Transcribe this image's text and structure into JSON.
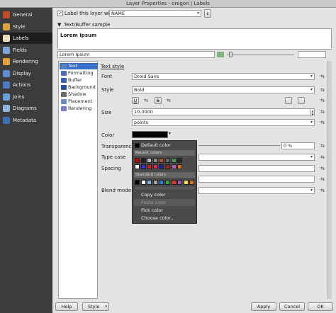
{
  "window": {
    "title": "Layer Properties - oregon | Labels"
  },
  "sidebar": {
    "items": [
      {
        "label": "General",
        "color": "#c04c2a"
      },
      {
        "label": "Style",
        "color": "#d9a441"
      },
      {
        "label": "Labels",
        "color": "#e8e0c0"
      },
      {
        "label": "Fields",
        "color": "#7ca7d8"
      },
      {
        "label": "Rendering",
        "color": "#e2a03a"
      },
      {
        "label": "Display",
        "color": "#5a8fd0"
      },
      {
        "label": "Actions",
        "color": "#4a7cc4"
      },
      {
        "label": "Joins",
        "color": "#6aa0d8"
      },
      {
        "label": "Diagrams",
        "color": "#8fb4e0"
      },
      {
        "label": "Metadata",
        "color": "#3f6fb5"
      }
    ]
  },
  "label_header": {
    "checkbox_label": "Label this layer with",
    "field_value": "NAME",
    "expr_button": "ε"
  },
  "sample": {
    "section_title": "Text/Buffer sample",
    "preview_text": "Lorem Ipsum",
    "input_value": "Lorem Ipsum"
  },
  "tree": {
    "items": [
      "Text",
      "Formatting",
      "Buffer",
      "Background",
      "Shadow",
      "Placement",
      "Rendering"
    ]
  },
  "text_style": {
    "heading": "Text style",
    "font_label": "Font",
    "font_value": "Droid Sans",
    "style_label": "Style",
    "style_value": "Bold",
    "format_buttons": [
      "U",
      "S"
    ],
    "size_label": "Size",
    "size_value": "10,0000",
    "size_unit": "points",
    "color_label": "Color",
    "color_value": "#000000",
    "transparency_label": "Transparency",
    "transparency_value": "0 %",
    "typecase_label": "Type case",
    "spacing_label": "Spacing",
    "blendmode_label": "Blend mode"
  },
  "color_menu": {
    "default_label": "Default color",
    "recent_heading": "Recent colors",
    "recent_row1": [
      "#cc0000",
      "#222222",
      "#bbbbbb",
      "#888888",
      "#b05030",
      "#666666",
      "#4a9a4a",
      "#2a2a2a"
    ],
    "recent_row2": [
      "#ffffff",
      "#3030d0",
      "#c02020",
      "#d03050",
      "#2020a0",
      "#a02020",
      "#b060b0",
      "#e07020"
    ],
    "standard_heading": "Standard colors",
    "standard_row": [
      "#000000",
      "#ffffff",
      "#7fb0d8",
      "#a0a0a0",
      "#2a7ad0",
      "#3aa040",
      "#e03030",
      "#9a50b0",
      "#e8e040",
      "#e07020"
    ],
    "copy_label": "Copy color",
    "paste_label": "Paste color",
    "pick_label": "Pick color",
    "choose_label": "Choose color..."
  },
  "footer": {
    "help": "Help",
    "style": "Style",
    "apply": "Apply",
    "cancel": "Cancel",
    "ok": "OK"
  }
}
